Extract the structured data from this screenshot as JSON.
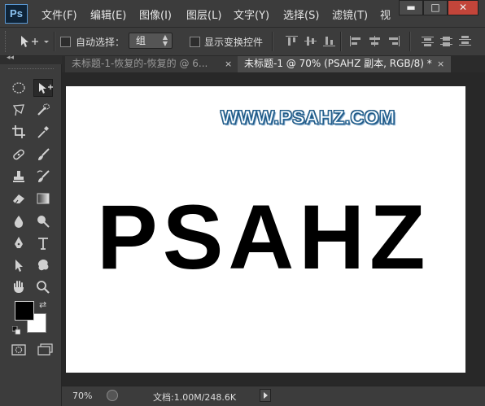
{
  "app": {
    "logo": "Ps"
  },
  "menu": [
    "文件(F)",
    "编辑(E)",
    "图像(I)",
    "图层(L)",
    "文字(Y)",
    "选择(S)",
    "滤镜(T)",
    "视"
  ],
  "window_controls": {
    "minimize": "▬",
    "maximize": "□",
    "close": "✕"
  },
  "options": {
    "auto_select_label": "自动选择：",
    "auto_select_checked": false,
    "layer_select_value": "组",
    "show_transform_label": "显示变换控件",
    "show_transform_checked": false
  },
  "tabs": [
    {
      "label": "未标题-1-恢复的-恢复的 @ 6...",
      "active": false,
      "close": "×"
    },
    {
      "label": "未标题-1 @ 70% (PSAHZ 副本, RGB/8) *",
      "active": true,
      "close": "×"
    }
  ],
  "canvas": {
    "watermark": "WWW.PSAHZ.COM",
    "main_text": "PSAHZ",
    "background": "#ffffff"
  },
  "status": {
    "zoom": "70%",
    "doc_info": "文档:1.00M/248.6K"
  },
  "colors": {
    "foreground": "#000000",
    "background": "#ffffff",
    "ui_panel": "#3c3c3c",
    "accent_logo": "#5a9ad6"
  },
  "tools": [
    [
      "elliptical-marquee-icon",
      "move-icon"
    ],
    [
      "lasso-icon",
      "quick-selection-icon"
    ],
    [
      "crop-icon",
      "eyedropper-icon"
    ],
    [
      "healing-brush-icon",
      "brush-icon"
    ],
    [
      "clone-stamp-icon",
      "history-brush-icon"
    ],
    [
      "eraser-icon",
      "gradient-icon"
    ],
    [
      "blur-icon",
      "dodge-icon"
    ],
    [
      "pen-icon",
      "type-icon"
    ],
    [
      "path-selection-icon",
      "custom-shape-icon"
    ],
    [
      "hand-icon",
      "zoom-icon"
    ]
  ]
}
